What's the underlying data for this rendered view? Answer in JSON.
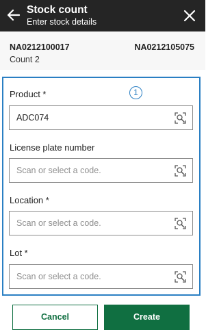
{
  "header": {
    "title": "Stock count",
    "subtitle": "Enter stock details"
  },
  "info": {
    "doc_left": "NA0212100017",
    "doc_right": "NA0212105075",
    "count_label": "Count 2"
  },
  "callout": "1",
  "form": {
    "fields": [
      {
        "label": "Product *",
        "value": "ADC074",
        "placeholder": ""
      },
      {
        "label": "License plate number",
        "value": "",
        "placeholder": "Scan or select a code."
      },
      {
        "label": "Location *",
        "value": "",
        "placeholder": "Scan or select a code."
      },
      {
        "label": "Lot *",
        "value": "",
        "placeholder": "Scan or select a code."
      }
    ]
  },
  "buttons": {
    "cancel": "Cancel",
    "create": "Create"
  },
  "colors": {
    "header_bg": "#252525",
    "accent_green": "#106f41",
    "highlight_blue": "#2a7fc3"
  },
  "icons": {
    "back": "arrow-left-icon",
    "close": "close-icon",
    "scan": "scan-search-icon"
  }
}
